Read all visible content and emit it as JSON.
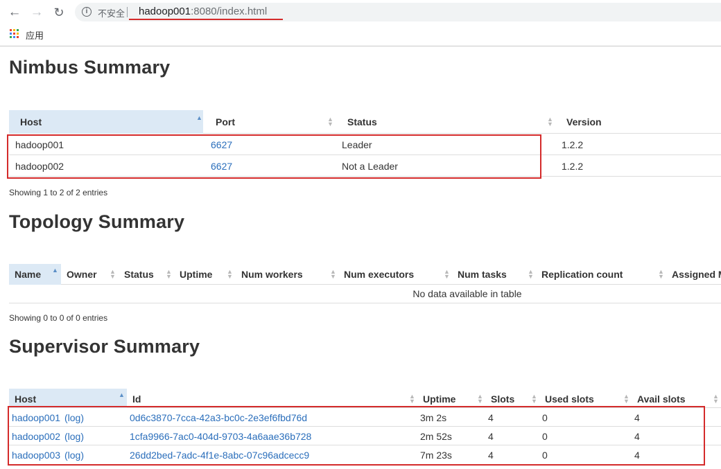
{
  "browser": {
    "security_label": "不安全",
    "url_host": "hadoop001",
    "url_rest": ":8080/index.html",
    "bookmarks_apps_label": "应用",
    "apps_colors": [
      "#ea4335",
      "#fbbc05",
      "#34a853",
      "#4285f4",
      "#ea4335",
      "#fbbc05",
      "#34a853",
      "#4285f4",
      "#ea4335"
    ]
  },
  "nimbus": {
    "title": "Nimbus Summary",
    "headers": {
      "host": "Host",
      "port": "Port",
      "status": "Status",
      "version": "Version"
    },
    "rows": [
      {
        "host": "hadoop001",
        "port": "6627",
        "status": "Leader",
        "version": "1.2.2"
      },
      {
        "host": "hadoop002",
        "port": "6627",
        "status": "Not a Leader",
        "version": "1.2.2"
      }
    ],
    "info": "Showing 1 to 2 of 2 entries"
  },
  "topology": {
    "title": "Topology Summary",
    "headers": {
      "name": "Name",
      "owner": "Owner",
      "status": "Status",
      "uptime": "Uptime",
      "num_workers": "Num workers",
      "num_executors": "Num executors",
      "num_tasks": "Num tasks",
      "replication_count": "Replication count",
      "assigned": "Assigned M"
    },
    "empty_message": "No data available in table",
    "info": "Showing 0 to 0 of 0 entries"
  },
  "supervisor": {
    "title": "Supervisor Summary",
    "headers": {
      "host": "Host",
      "id": "Id",
      "uptime": "Uptime",
      "slots": "Slots",
      "used_slots": "Used slots",
      "avail_slots": "Avail slots"
    },
    "log_label": "(log)",
    "rows": [
      {
        "host": "hadoop001",
        "id": "0d6c3870-7cca-42a3-bc0c-2e3ef6fbd76d",
        "uptime": "3m 2s",
        "slots": "4",
        "used": "0",
        "avail": "4"
      },
      {
        "host": "hadoop002",
        "id": "1cfa9966-7ac0-404d-9703-4a6aae36b728",
        "uptime": "2m 52s",
        "slots": "4",
        "used": "0",
        "avail": "4"
      },
      {
        "host": "hadoop003",
        "id": "26dd2bed-7adc-4f1e-8abc-07c96adcecc9",
        "uptime": "7m 23s",
        "slots": "4",
        "used": "0",
        "avail": "4"
      }
    ]
  },
  "colors": {
    "annotation_red": "#d42a2a",
    "link": "#2a6ebb",
    "sorted_header_bg": "#dce9f5"
  }
}
